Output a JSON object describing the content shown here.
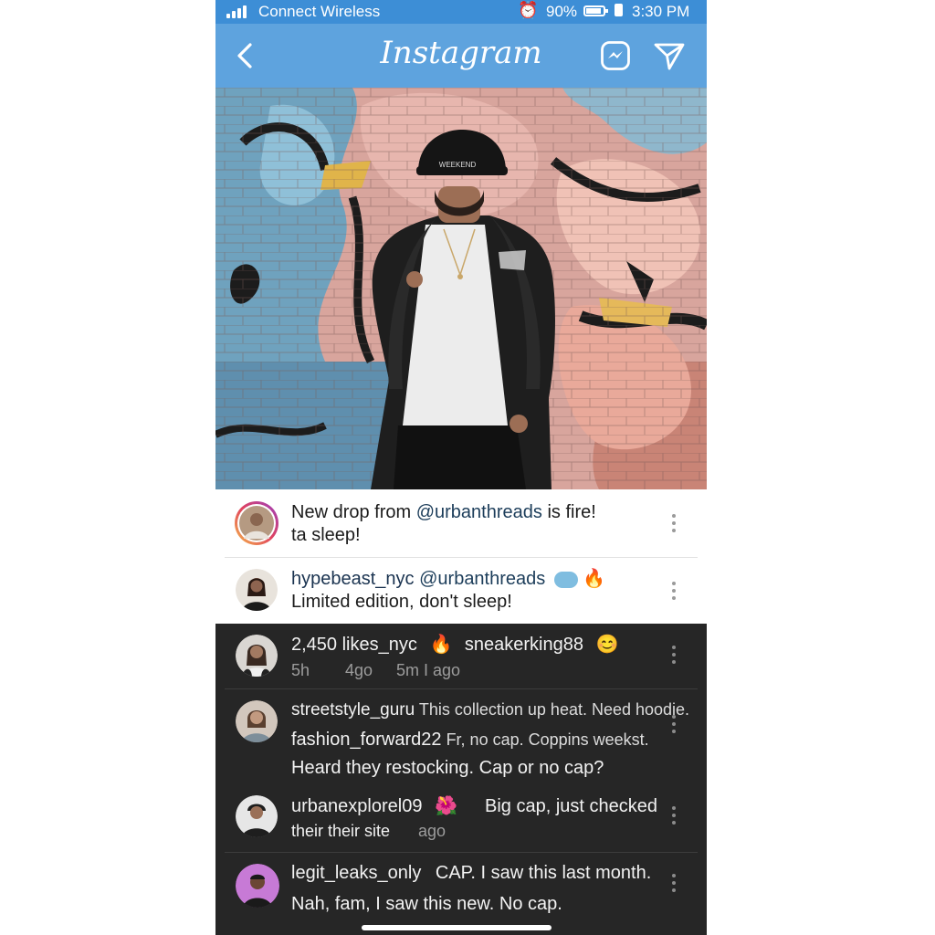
{
  "status_bar": {
    "carrier": "Connect Wireless",
    "battery_percent": "90%",
    "time": "3:30 PM"
  },
  "header": {
    "title": "Instagram",
    "icons": [
      "back-chevron-icon",
      "messenger-icon",
      "send-icon"
    ]
  },
  "post": {
    "cap_text": "WEEKEND"
  },
  "comments_light": [
    {
      "username_prefix": "New drop from ",
      "mention": "@urbanthreads",
      "suffix": " is fire!",
      "line2": "ta sleep!"
    },
    {
      "username": "hypebeast_nyc",
      "mention": " @urbanthreads",
      "emoji": "🔥",
      "line2": "Limited edition, don't sleep!"
    }
  ],
  "comments_dark": [
    {
      "line1_a": "2,450 likes_nyc",
      "emoji_a": "🔥",
      "line1_b": "sneakerking88",
      "emoji_b": "😊",
      "time1": "5h",
      "time2": "4go",
      "time3": "5m I ago"
    },
    {
      "username": "streetstyle_guru",
      "text": " This collection up heat. Need hoodie.",
      "line2_user": "fashion_forward22",
      "line2_text": " Fr, no cap. Coppins weekst.",
      "line3": "Heard they restocking. Cap or no cap?"
    },
    {
      "username": "urbanexplorel09",
      "emoji": "🌺",
      "text": "Big cap, just checked",
      "line2": "their their site",
      "time": "ago"
    },
    {
      "username": "legit_leaks_only",
      "text": "CAP. I saw this last month.",
      "line2": "Nah, fam, I saw this new. No cap."
    }
  ],
  "colors": {
    "status_bar": "#3d8ed6",
    "header": "#5ea3de",
    "dark_panel": "#262626"
  }
}
